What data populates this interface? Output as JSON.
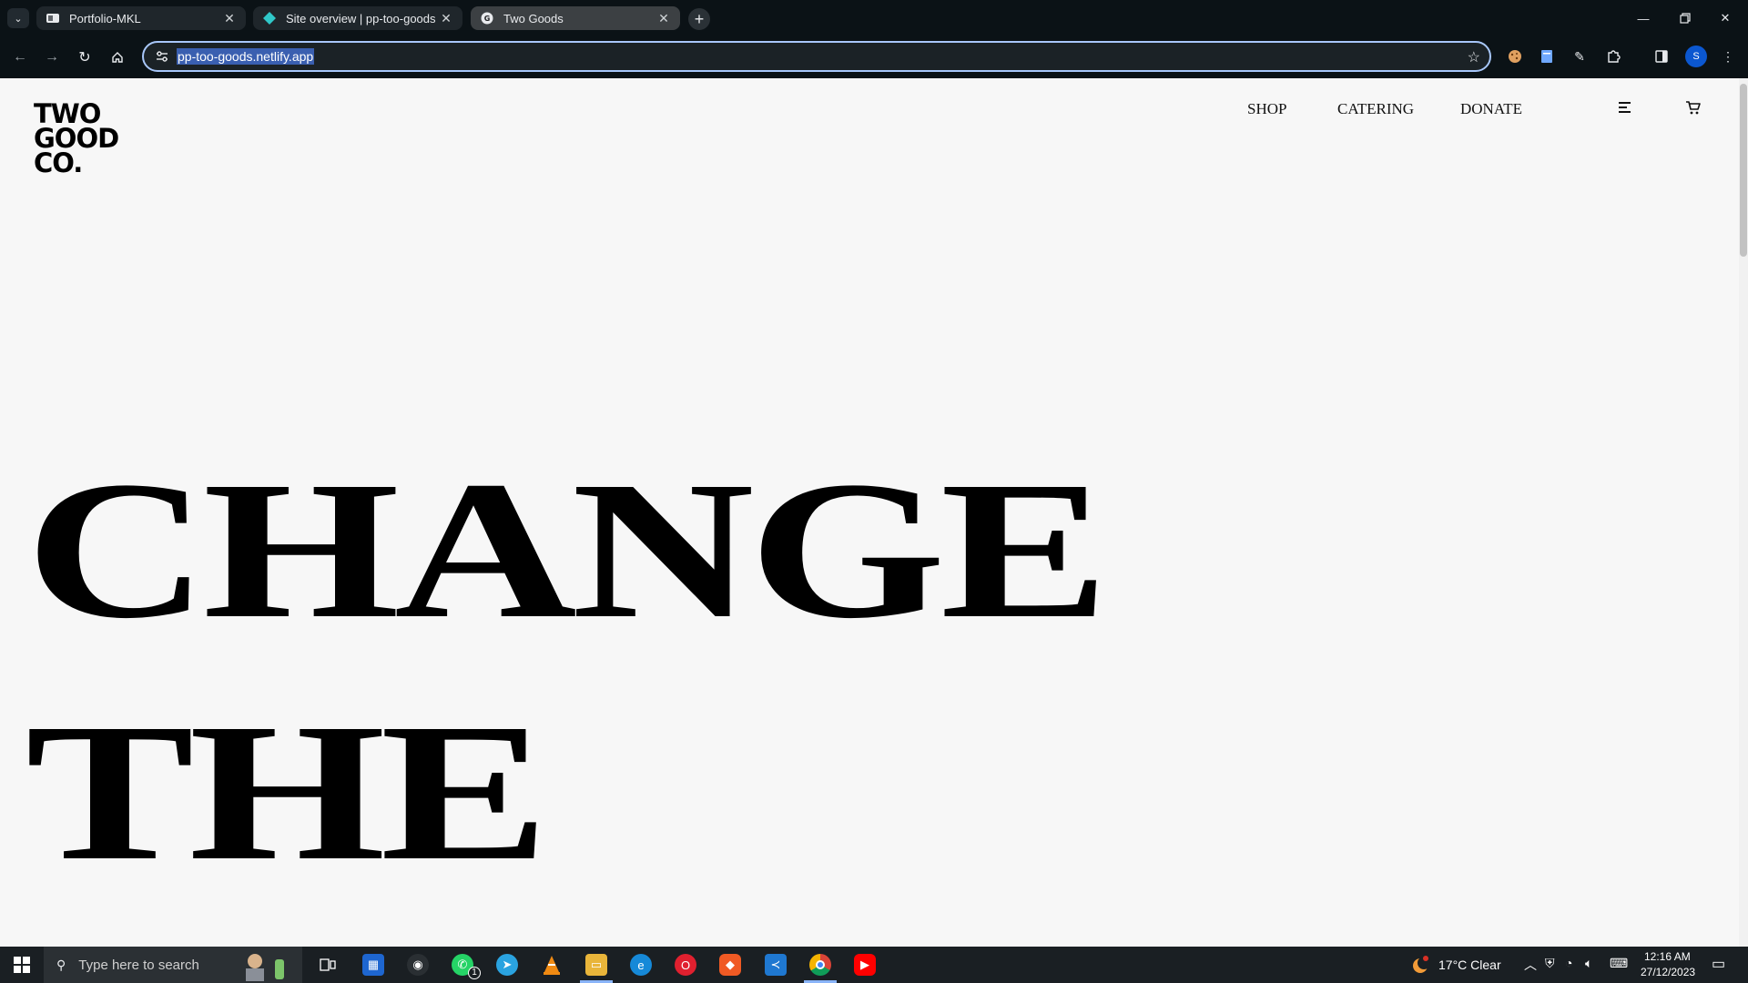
{
  "browser": {
    "tabs": [
      {
        "title": "Portfolio-MKL",
        "active": false
      },
      {
        "title": "Site overview | pp-too-goods |",
        "active": false
      },
      {
        "title": "Two Goods",
        "active": true
      }
    ],
    "url": "pp-too-goods.netlify.app",
    "profile_initial": "S"
  },
  "site": {
    "logo_lines": [
      "TWO",
      "GOOD",
      "CO."
    ],
    "nav": [
      "SHOP",
      "CATERING",
      "DONATE"
    ],
    "hero_lines": [
      "CHANGE",
      "THE"
    ]
  },
  "taskbar": {
    "search_placeholder": "Type here to search",
    "weather": "17°C  Clear",
    "time": "12:16 AM",
    "date": "27/12/2023",
    "whatsapp_badge": "1"
  },
  "colors": {
    "page_bg": "#f7f7f7",
    "chrome_bg": "#0b1216",
    "url_highlight": "#3a5fb0",
    "accent_focus": "#a8c7fa"
  }
}
